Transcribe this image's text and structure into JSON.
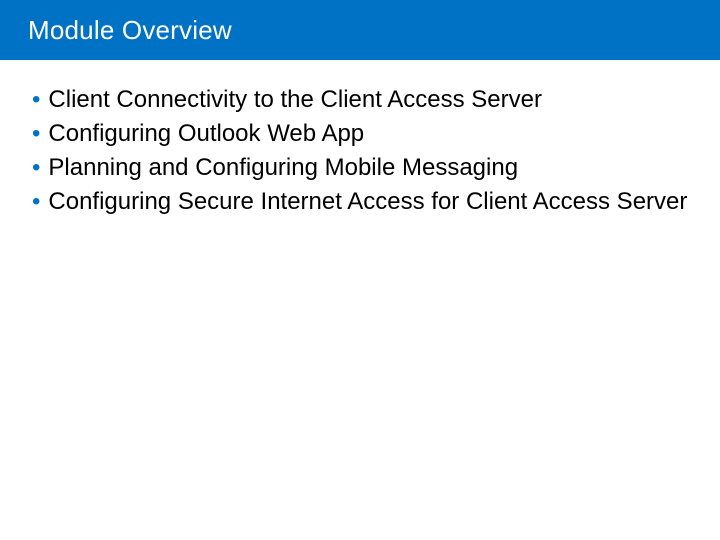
{
  "header": {
    "title": "Module Overview"
  },
  "bullets": {
    "item0": "Client Connectivity to the Client Access Server",
    "item1": "Configuring Outlook Web App",
    "item2": "Planning and Configuring Mobile Messaging",
    "item3": "Configuring Secure Internet Access for Client Access Server"
  },
  "colors": {
    "accent": "#0072c6"
  }
}
